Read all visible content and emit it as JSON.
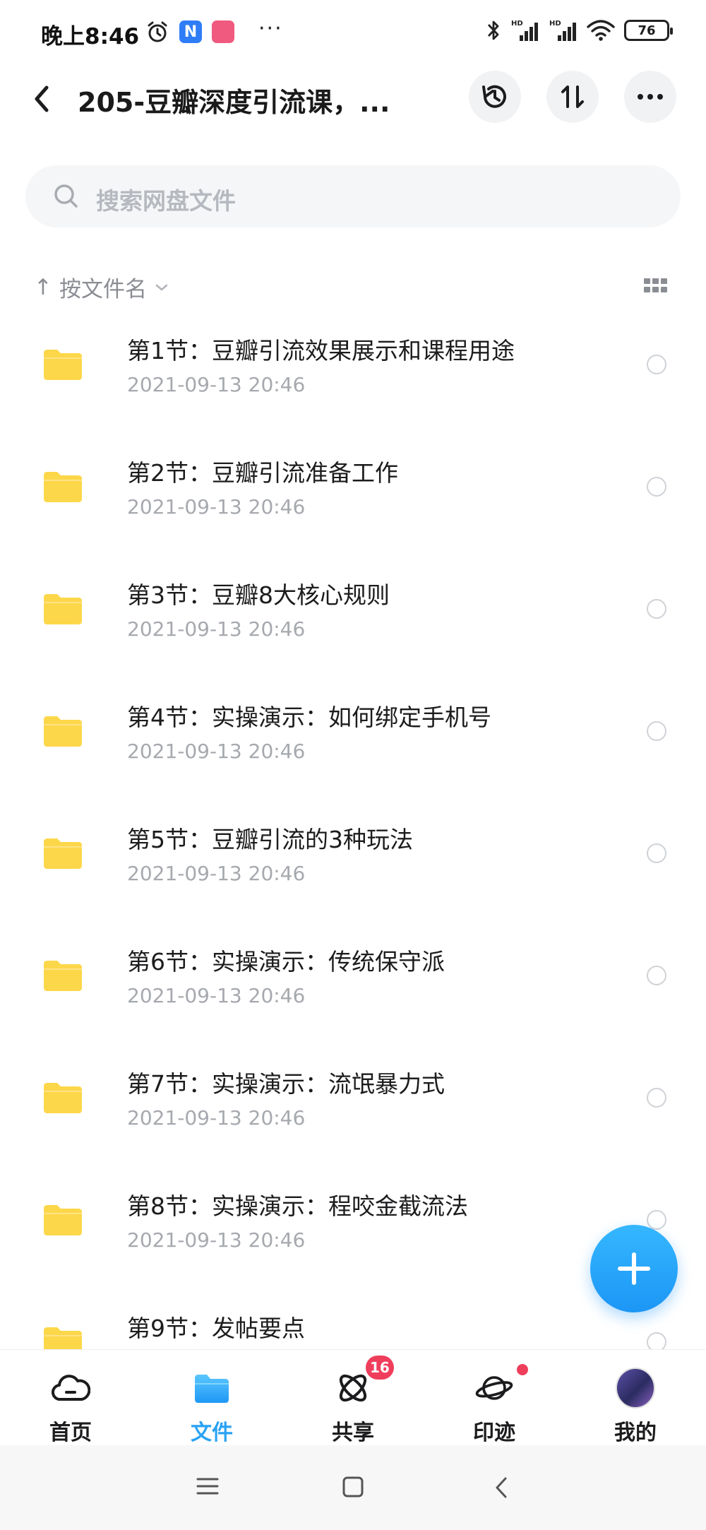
{
  "status_bar": {
    "time": "晚上8:46",
    "app_n_letter": "N",
    "battery": "76",
    "more": "···"
  },
  "header": {
    "title": "205-豆瓣深度引流课，...",
    "icons": [
      "back-icon",
      "history-icon",
      "sort-icon",
      "more-icon"
    ]
  },
  "search": {
    "placeholder": "搜索网盘文件"
  },
  "sort": {
    "arrow": "↑",
    "label": "按文件名",
    "chevron": "⌄"
  },
  "files": [
    {
      "name": "第1节：豆瓣引流效果展示和课程用途",
      "date": "2021-09-13  20:46"
    },
    {
      "name": "第2节：豆瓣引流准备工作",
      "date": "2021-09-13  20:46"
    },
    {
      "name": "第3节：豆瓣8大核心规则",
      "date": "2021-09-13  20:46"
    },
    {
      "name": "第4节：实操演示：如何绑定手机号",
      "date": "2021-09-13  20:46"
    },
    {
      "name": "第5节：豆瓣引流的3种玩法",
      "date": "2021-09-13  20:46"
    },
    {
      "name": "第6节：实操演示：传统保守派",
      "date": "2021-09-13  20:46"
    },
    {
      "name": "第7节：实操演示：流氓暴力式",
      "date": "2021-09-13  20:46"
    },
    {
      "name": "第8节：实操演示：程咬金截流法",
      "date": "2021-09-13  20:46"
    },
    {
      "name": "第9节：发帖要点",
      "date": ""
    }
  ],
  "tabs": [
    {
      "label": "首页",
      "icon": "cloud-home-icon"
    },
    {
      "label": "文件",
      "icon": "folder-icon",
      "active": true
    },
    {
      "label": "共享",
      "icon": "share-atom-icon",
      "badge": "16"
    },
    {
      "label": "印迹",
      "icon": "planet-icon"
    },
    {
      "label": "我的",
      "icon": "avatar"
    }
  ],
  "colors": {
    "accent": "#2aa3f5",
    "folder": "#fdd74a",
    "badge": "#ef3e5c"
  }
}
